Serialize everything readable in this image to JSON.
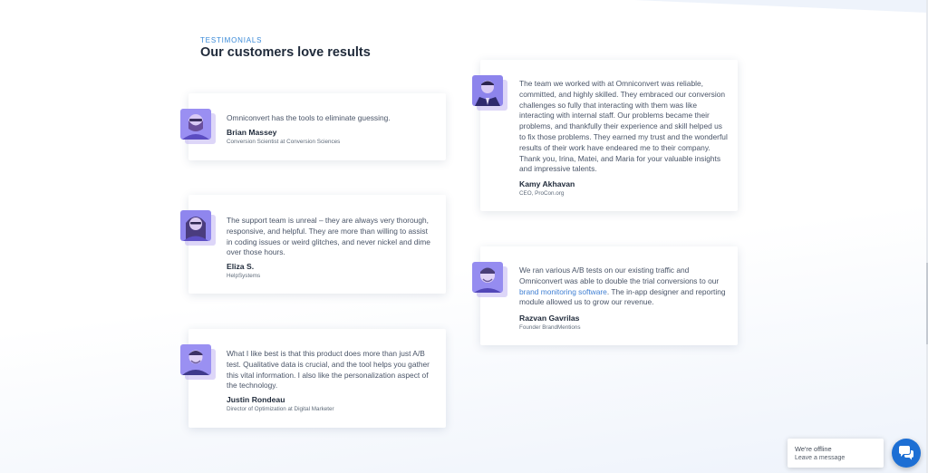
{
  "section": {
    "eyebrow": "TESTIMONIALS",
    "title": "Our customers love results"
  },
  "testimonials": [
    {
      "quote": "Omniconvert has the tools to eliminate guessing.",
      "name": "Brian Massey",
      "role": "Conversion Scientist at Conversion Sciences"
    },
    {
      "quote": "The support team is unreal – they are always very thorough, responsive, and helpful. They are more than willing to assist in coding issues or weird glitches, and never nickel and dime over those hours.",
      "name": "Eliza S.",
      "role": "HelpSystems"
    },
    {
      "quote": "What I like best is that this product does more than just A/B test. Qualitative data is crucial, and the tool helps you gather this vital information. I also like the personalization aspect of the technology.",
      "name": "Justin Rondeau",
      "role": "Director of Optimization at Digital Marketer"
    },
    {
      "quote": "The team we worked with at Omniconvert was reliable, committed, and highly skilled. They embraced our conversion challenges so fully that interacting with them was like interacting with internal staff. Our problems became their problems, and thankfully their experience and skill helped us to fix those problems. They earned my trust and the wonderful results of their work have endeared me to their company. Thank you, Irina, Matei, and Maria for your valuable insights and impressive talents.",
      "name": "Kamy Akhavan",
      "role": "CEO, ProCon.org"
    },
    {
      "quote_before": "We ran various A/B tests on our existing traffic and Omniconvert was able to double the trial conversions to our ",
      "quote_link": "brand monitoring software",
      "quote_after": ". The in-app designer and reporting module allowed us to grow our revenue.",
      "name": "Razvan Gavrilas",
      "role": "Founder BrandMentions"
    }
  ],
  "chat": {
    "status": "We're offline",
    "action": "Leave a message",
    "icon": "chat-bubbles-icon"
  },
  "colors": {
    "accent": "#3a8ad8",
    "title": "#1f2a3a",
    "chat_button": "#1d6fd4",
    "avatar_tint": "#8b7cf0"
  }
}
